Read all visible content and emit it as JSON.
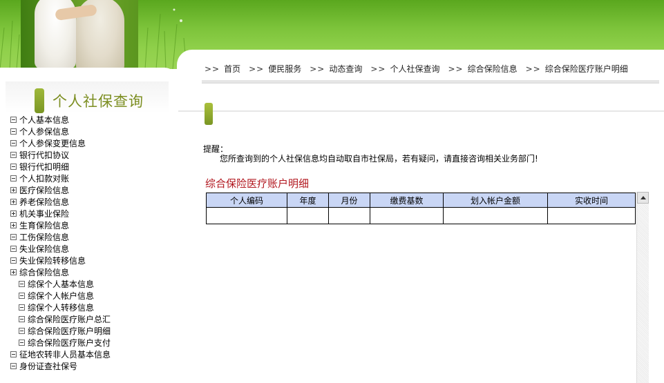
{
  "breadcrumb": {
    "separator": ">>",
    "items": [
      "首页",
      "便民服务",
      "动态查询",
      "个人社保查询",
      "综合保险信息",
      "综合保险医疗账户明细"
    ]
  },
  "sidebar": {
    "title": "个人社保查询",
    "items": [
      {
        "label": "个人基本信息",
        "expander": "minus"
      },
      {
        "label": "个人参保信息",
        "expander": "minus"
      },
      {
        "label": "个人参保变更信息",
        "expander": "minus"
      },
      {
        "label": "银行代扣协议",
        "expander": "minus"
      },
      {
        "label": "银行代扣明细",
        "expander": "minus"
      },
      {
        "label": "个人扣款对账",
        "expander": "minus"
      },
      {
        "label": "医疗保险信息",
        "expander": "plus"
      },
      {
        "label": "养老保险信息",
        "expander": "plus"
      },
      {
        "label": "机关事业保险",
        "expander": "plus"
      },
      {
        "label": "生育保险信息",
        "expander": "plus"
      },
      {
        "label": "工伤保险信息",
        "expander": "minus"
      },
      {
        "label": "失业保险信息",
        "expander": "minus"
      },
      {
        "label": "失业保险转移信息",
        "expander": "minus"
      },
      {
        "label": "综合保险信息",
        "expander": "plus"
      },
      {
        "label": "综保个人基本信息",
        "expander": "minus",
        "child": true
      },
      {
        "label": "综保个人帐户信息",
        "expander": "minus",
        "child": true
      },
      {
        "label": "综保个人转移信息",
        "expander": "minus",
        "child": true
      },
      {
        "label": "综合保险医疗账户总汇",
        "expander": "minus",
        "child": true
      },
      {
        "label": "综合保险医疗账户明细",
        "expander": "minus",
        "child": true
      },
      {
        "label": "综合保险医疗账户支付",
        "expander": "minus",
        "child": true
      },
      {
        "label": "征地农转非人员基本信息",
        "expander": "minus"
      },
      {
        "label": "身份证查社保号",
        "expander": "minus"
      }
    ]
  },
  "notice": {
    "label": "提醒：",
    "text": "您所查询到的个人社保信息均自动取自市社保局，若有疑问，请直接咨询相关业务部门!"
  },
  "table": {
    "title": "综合保险医疗账户明细",
    "columns": [
      "个人编码",
      "年度",
      "月份",
      "缴费基数",
      "划入帐户金额",
      "实收时间"
    ],
    "rows": [
      [
        "",
        "",
        "",
        "",
        "",
        ""
      ]
    ]
  },
  "colors": {
    "banner_green": "#7cc33a",
    "title_olive": "#7c8e21",
    "table_title_red": "#b1151d",
    "table_header_blue": "#c9d6f5"
  }
}
